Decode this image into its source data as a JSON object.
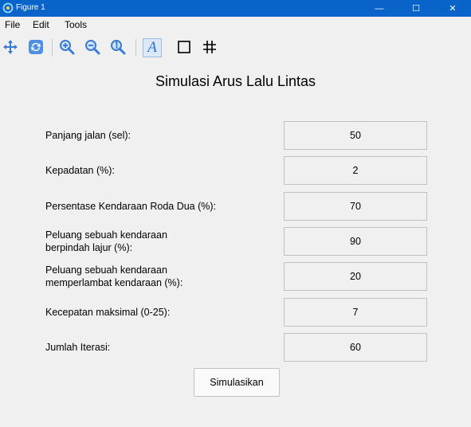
{
  "window": {
    "title": "Figure 1",
    "controls": {
      "minimize": "—",
      "maximize": "☐",
      "close": "✕"
    }
  },
  "menu": [
    "File",
    "Edit",
    "Tools"
  ],
  "toolbar": {
    "icons": [
      "move-icon",
      "refresh-icon",
      "zoom-in-icon",
      "zoom-out-icon",
      "zoom-reset-icon",
      "text-icon",
      "rectangle-icon",
      "grid-icon"
    ],
    "text_tool_glyph": "A"
  },
  "form": {
    "title": "Simulasi Arus Lalu Lintas",
    "fields": [
      {
        "label": "Panjang jalan (sel):",
        "value": "50"
      },
      {
        "label": "Kepadatan (%):",
        "value": "2"
      },
      {
        "label": "Persentase Kendaraan Roda Dua (%):",
        "value": "70"
      },
      {
        "label": "Peluang sebuah kendaraan\nberpindah lajur (%):",
        "value": "90"
      },
      {
        "label": "Peluang sebuah kendaraan\nmemperlambat kendaraan (%):",
        "value": "20"
      },
      {
        "label": "Kecepatan maksimal (0-25):",
        "value": "7"
      },
      {
        "label": "Jumlah Iterasi:",
        "value": "60"
      }
    ],
    "submit_label": "Simulasikan"
  }
}
